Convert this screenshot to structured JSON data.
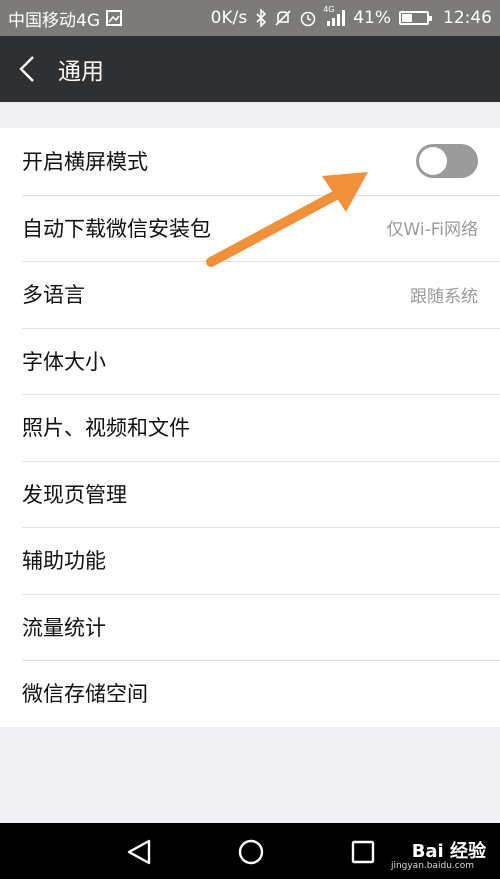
{
  "status_bar": {
    "carrier": "中国移动4G",
    "speed": "0K/s",
    "network_label": "4G",
    "battery_percent": "41%",
    "battery_level": 0.41,
    "time": "12:46"
  },
  "header": {
    "title": "通用",
    "back_icon": "chevron-left-icon"
  },
  "settings": {
    "items": [
      {
        "label": "开启横屏模式",
        "type": "toggle",
        "toggle_on": false
      },
      {
        "label": "自动下载微信安装包",
        "value": "仅Wi-Fi网络"
      },
      {
        "label": "多语言",
        "value": "跟随系统"
      },
      {
        "label": "字体大小"
      },
      {
        "label": "照片、视频和文件"
      },
      {
        "label": "发现页管理"
      },
      {
        "label": "辅助功能"
      },
      {
        "label": "流量统计"
      },
      {
        "label": "微信存储空间"
      }
    ]
  },
  "annotation": {
    "color": "#f0913a"
  },
  "nav_bar": {
    "watermark": "Bai 经验",
    "watermark_sub": "jingyan.baidu.com"
  },
  "colors": {
    "header_bg": "#2f3032",
    "status_bg": "#7d7b78",
    "page_bg": "#efeff4",
    "toggle_off": "#9b9b9b"
  }
}
